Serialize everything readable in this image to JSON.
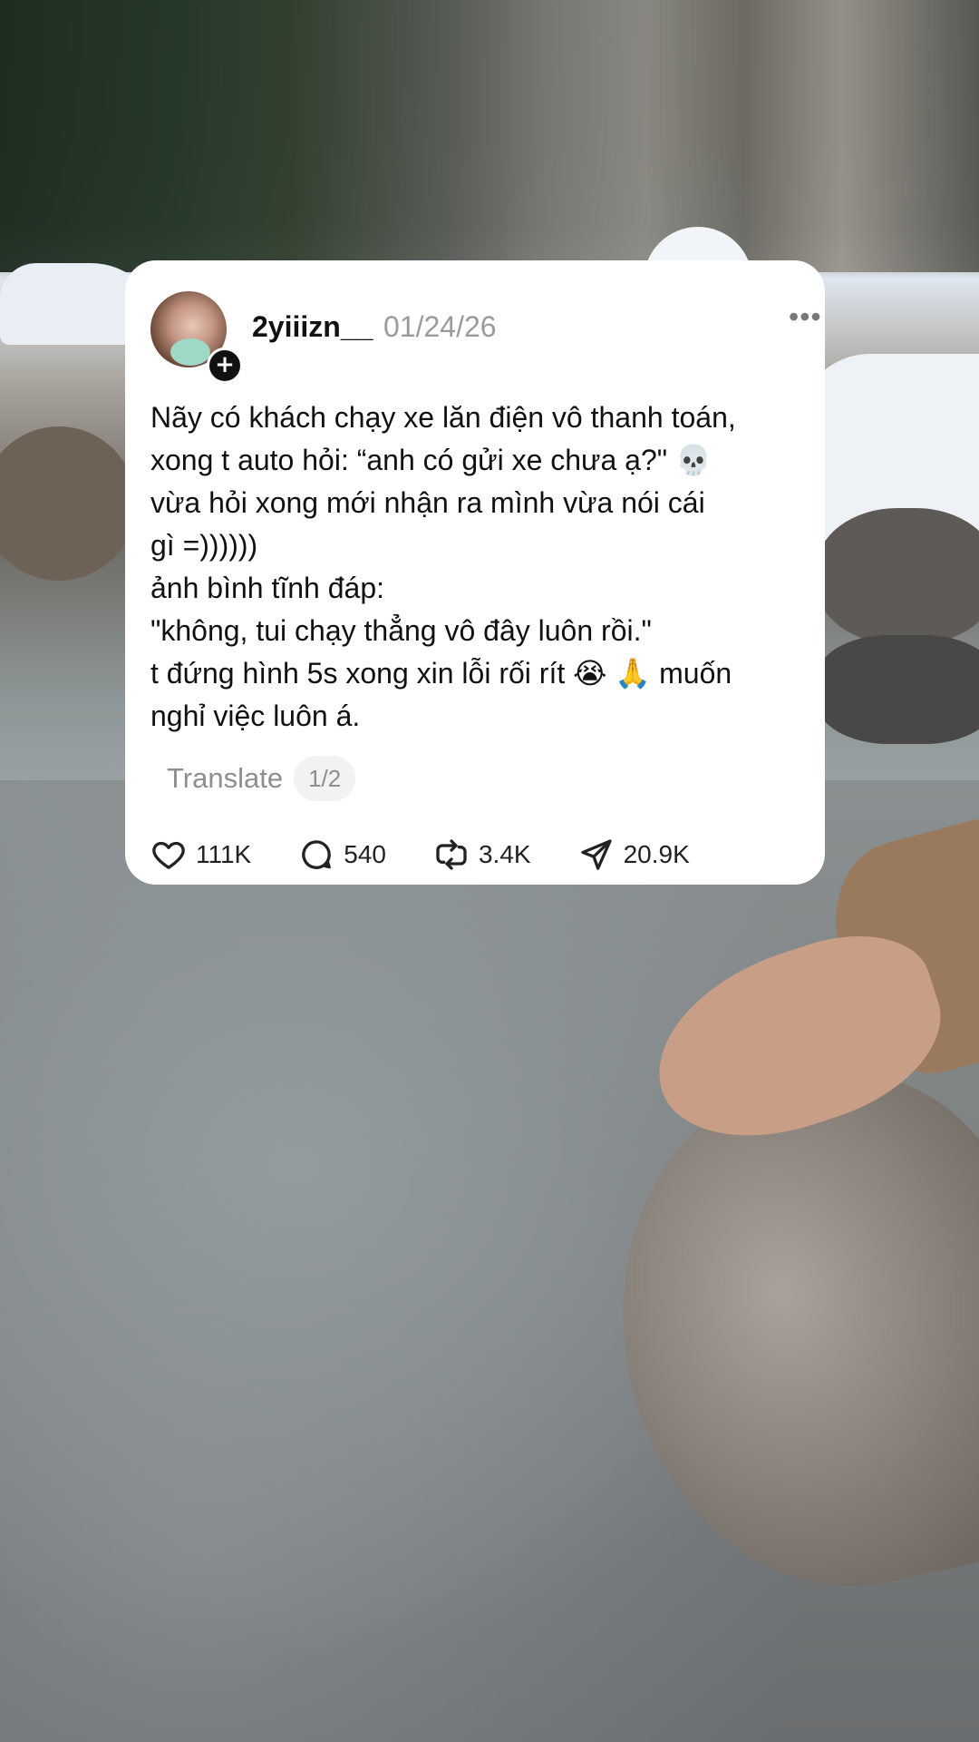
{
  "post": {
    "username": "2yiiizn__",
    "date": "01/24/26",
    "more_label": "•••",
    "text": "Nãy có khách chạy xe lăn điện vô thanh toán,\nxong t auto hỏi: “anh có gửi xe chưa ạ?\" 💀\nvừa hỏi xong mới nhận ra mình vừa nói cái\ngì =))))))\nảnh bình tĩnh đáp:\n\"không, tui chạy thẳng vô đây luôn rồi.\"\nt đứng hình 5s xong xin lỗi rối rít 😭 🙏 muốn\nnghỉ việc luôn á.",
    "translate_label": "Translate",
    "page_indicator": "1/2",
    "avatar_badge": "+"
  },
  "actions": {
    "likes": "111K",
    "comments": "540",
    "reposts": "3.4K",
    "shares": "20.9K"
  },
  "icons": {
    "like": "heart-icon",
    "comment": "comment-bubble-icon",
    "repost": "repost-icon",
    "share": "send-icon",
    "more": "more-dots-icon",
    "follow": "plus-icon"
  },
  "colors": {
    "card_bg": "#ffffff",
    "text": "#111111",
    "muted": "#9b9b9b"
  }
}
